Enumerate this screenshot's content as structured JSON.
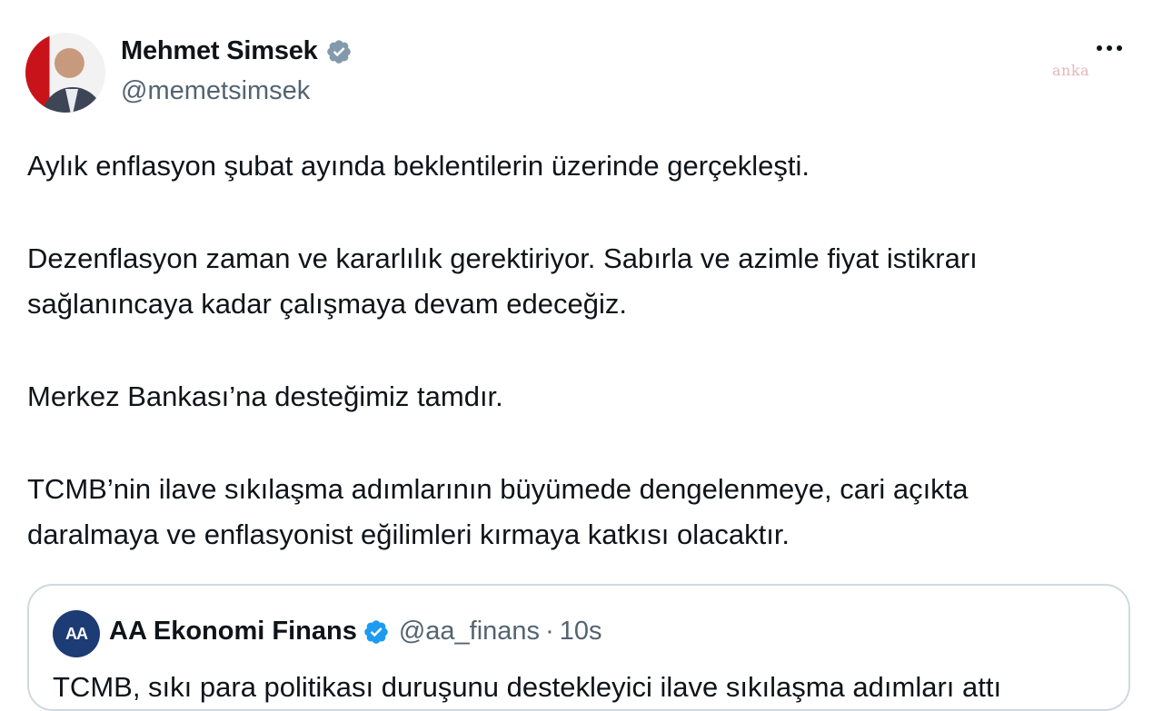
{
  "author": {
    "display_name": "Mehmet Simsek",
    "handle": "@memetsimsek",
    "verified_icon": "verified-badge-icon"
  },
  "watermark": "anka",
  "tweet": {
    "paragraphs": [
      "Aylık enflasyon şubat ayında beklentilerin üzerinde gerçekleşti.",
      "Dezenflasyon zaman ve kararlılık gerektiriyor. Sabırla ve azimle fiyat istikrarı sağlanıncaya kadar çalışmaya devam edeceğiz.",
      "Merkez Bankası’na desteğimiz tamdır.",
      "TCMB’nin ilave sıkılaşma adımlarının büyümede dengelenmeye, cari açıkta daralmaya ve enflasyonist eğilimleri kırmaya katkısı olacaktır."
    ]
  },
  "quote": {
    "avatar_text": "AA",
    "display_name": "AA Ekonomi Finans",
    "handle": "@aa_finans",
    "separator": "·",
    "time": "10s",
    "text": "TCMB, sıkı para politikası duruşunu destekleyici ilave sıkılaşma adımları attı"
  },
  "colors": {
    "text": "#0f1419",
    "secondary": "#536471",
    "verified": "#829aab",
    "border": "#cfd9de"
  }
}
